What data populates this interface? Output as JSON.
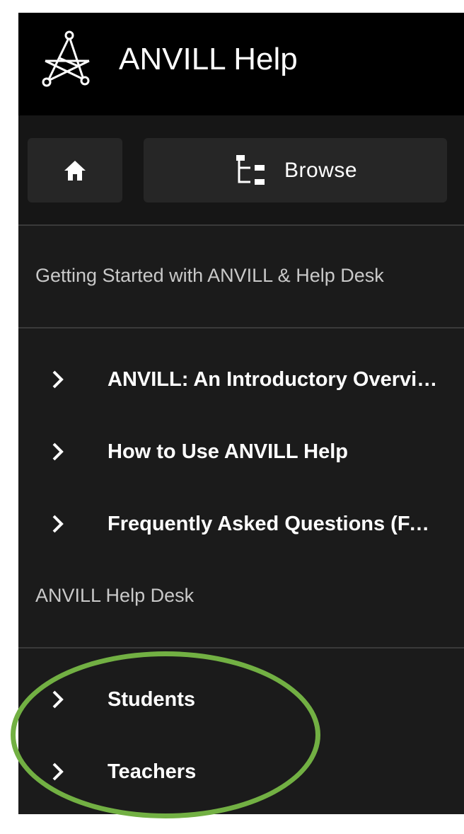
{
  "header": {
    "title": "ANVILL Help",
    "logo_icon": "anvill-network-logo-icon"
  },
  "toolbar": {
    "home_icon": "home-icon",
    "browse_icon": "tree-structure-icon",
    "browse_label": "Browse"
  },
  "sections": [
    {
      "label": "Getting Started with ANVILL & Help Desk",
      "items": [
        {
          "label": "ANVILL: An Introductory Overview"
        },
        {
          "label": "How to Use ANVILL Help"
        },
        {
          "label": "Frequently Asked Questions (FAQ)"
        }
      ]
    },
    {
      "label": "ANVILL Help Desk",
      "items": [
        {
          "label": "Students"
        },
        {
          "label": "Teachers"
        }
      ]
    }
  ],
  "colors": {
    "panel_bg": "#1b1b1b",
    "header_bg": "#000000",
    "button_bg": "#262626",
    "highlight": "#72b043"
  }
}
